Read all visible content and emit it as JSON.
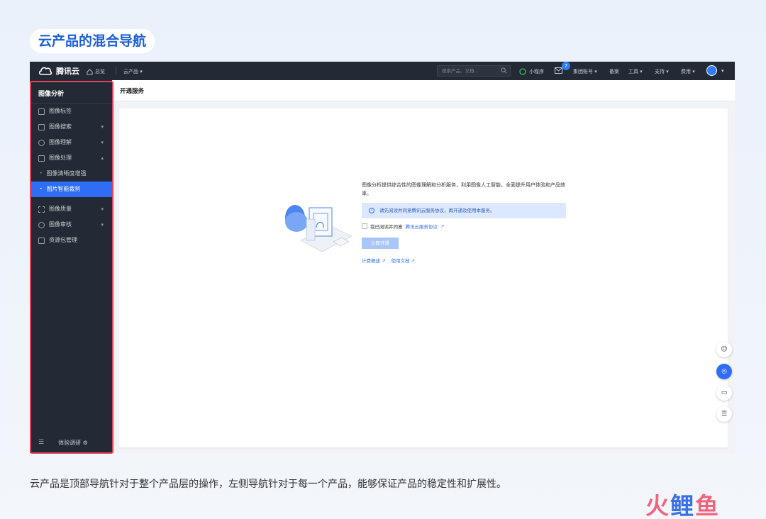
{
  "page_title": "云产品的混合导航",
  "caption": "云产品是顶部导航针对于整个产品层的操作，左侧导航针对于每一个产品，能够保证产品的稳定性和扩展性。",
  "watermark": {
    "part1": "火",
    "part2": "鲤",
    "part3": "鱼"
  },
  "topbar": {
    "brand": "腾讯云",
    "home": "总览",
    "products": "云产品 ▾",
    "search_placeholder": "搜索产品、文档...",
    "mini_program": "小程序",
    "mail_badge": "7",
    "group_account": "集团账号 ▾",
    "beian": "备案",
    "tools": "工具 ▾",
    "support": "支持 ▾",
    "billing": "费用 ▾",
    "avatar_caret": "▾"
  },
  "sidebar": {
    "title": "图像分析",
    "items": [
      {
        "label": "图像标签",
        "chevron": ""
      },
      {
        "label": "图像搜索",
        "chevron": "▾"
      },
      {
        "label": "图像理解",
        "chevron": "▾"
      },
      {
        "label": "图像处理",
        "chevron": "▴"
      },
      {
        "label": "图像清晰度增强",
        "chevron": ""
      },
      {
        "label": "图片智能裁剪",
        "chevron": ""
      },
      {
        "label": "图像质量",
        "chevron": "▾"
      },
      {
        "label": "图像审核",
        "chevron": "▾"
      },
      {
        "label": "资源包管理",
        "chevron": ""
      }
    ],
    "footer": "体验调研"
  },
  "main": {
    "heading": "开通服务",
    "description": "图像分析提供综合性的图像理解和分析服务，利用图像人工智能，全面提升用户体验和产品效率。",
    "notice": "请先阅读并同意腾讯云服务协议，再开通及使用本服务。",
    "agree_prefix": "我已阅读并同意",
    "agree_link": "腾讯云服务协议",
    "open_button": "立即开通",
    "link_pricing": "计费概述",
    "link_docs": "使用文档"
  },
  "colors": {
    "accent": "#2f6df6",
    "sidebar_bg": "#232a35",
    "highlight": "#e4415a"
  }
}
